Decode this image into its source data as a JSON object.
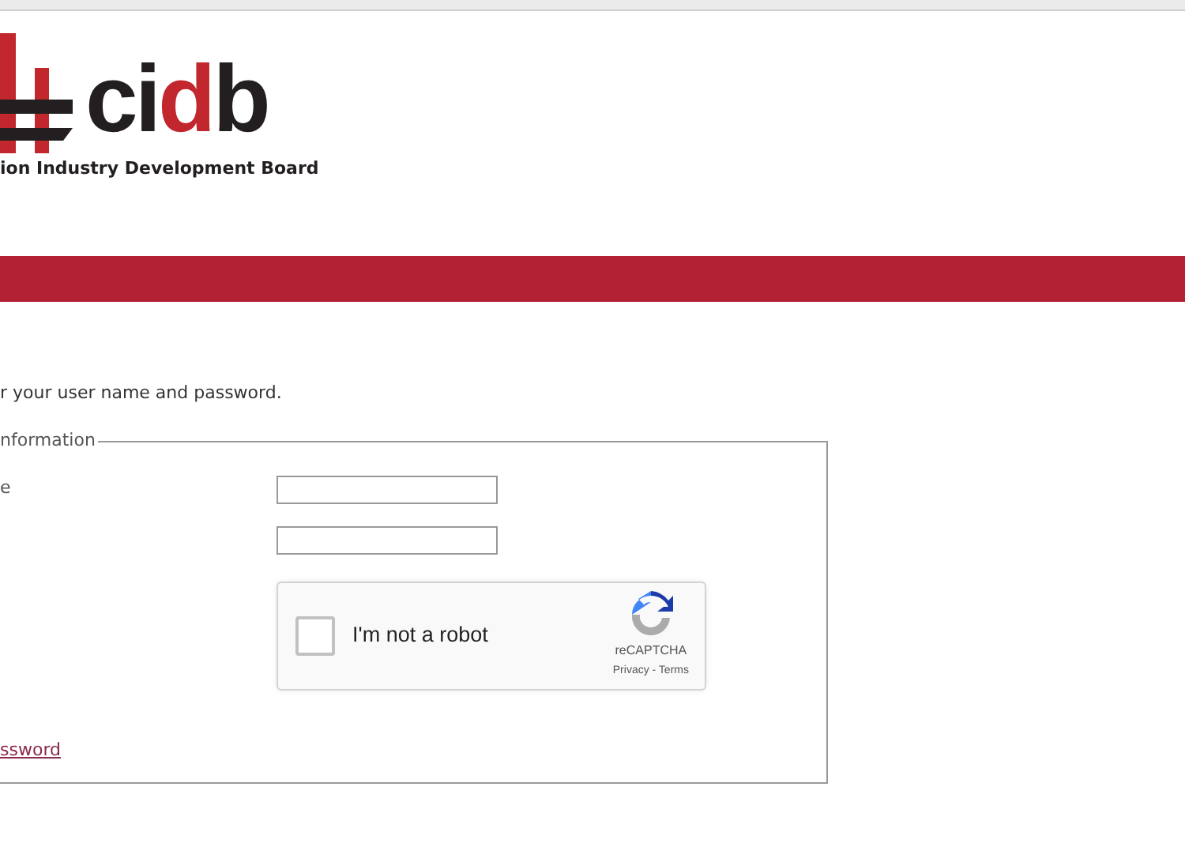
{
  "logo": {
    "letters": [
      {
        "text": "ci",
        "color": "#231f20"
      },
      {
        "text": "d",
        "color": "#c1272d"
      },
      {
        "text": "b",
        "color": "#231f20"
      }
    ],
    "tagline": "ion Industry Development Board"
  },
  "instructions": "r your user name and password.",
  "fieldset": {
    "legend": "nformation",
    "fields": [
      {
        "kind": "input",
        "label": "e"
      },
      {
        "kind": "input"
      }
    ],
    "captcha": {
      "label": "I'm not a robot",
      "checked": false,
      "brand": "reCAPTCHA",
      "links": "Privacy - Terms"
    },
    "link": "ssword"
  }
}
